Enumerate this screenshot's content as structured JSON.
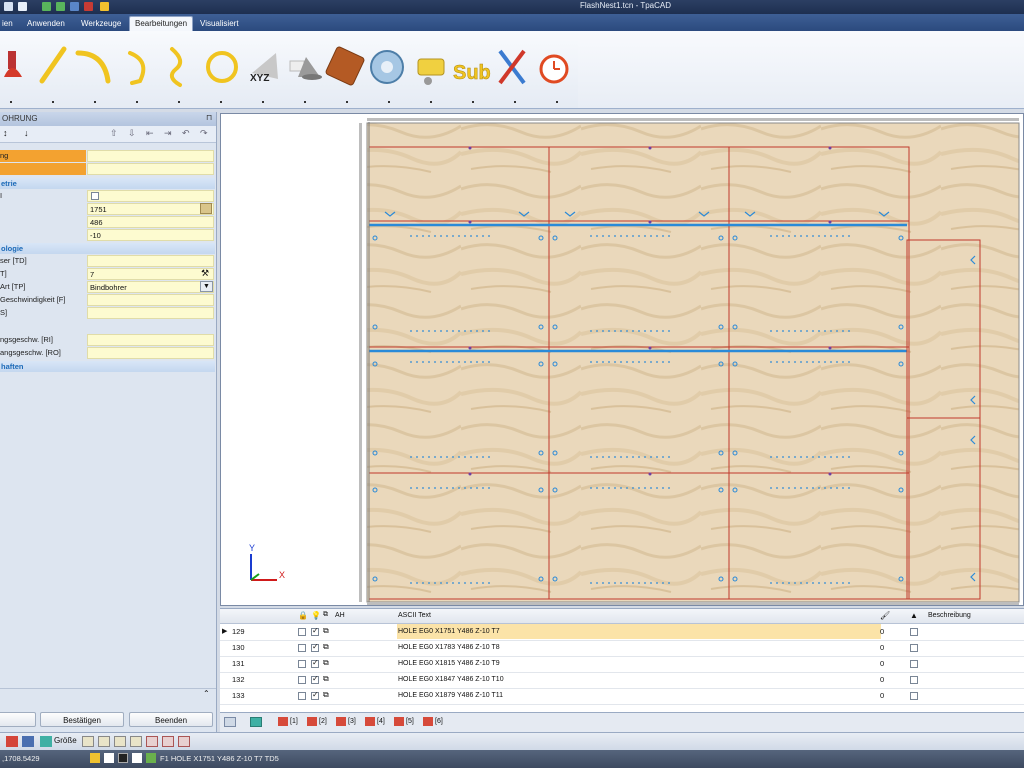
{
  "app": {
    "title": "FlashNest1.tcn - TpaCAD"
  },
  "ribbon_tabs": [
    {
      "label": "ien"
    },
    {
      "label": "Anwenden"
    },
    {
      "label": "Werkzeuge"
    },
    {
      "label": "Bearbeitungen"
    },
    {
      "label": "Visualisiert"
    }
  ],
  "ribbon_icons": {
    "sub_label": "Sub",
    "xyz_label": "XYZ"
  },
  "left_panel": {
    "title": "OHRUNG",
    "rows": [
      {
        "label": "ng",
        "value": "",
        "highlight": "orange"
      },
      {
        "label": "",
        "value": "",
        "highlight": "orange"
      }
    ],
    "cat1": "etrie",
    "geo_rows": [
      {
        "label": "I",
        "value": ""
      },
      {
        "label": "",
        "value": "1751"
      },
      {
        "label": "",
        "value": "486"
      },
      {
        "label": "",
        "value": "-10"
      }
    ],
    "cat2": "ologie",
    "tech_rows": [
      {
        "label": "ser [TD]",
        "value": ""
      },
      {
        "label": "T]",
        "value": "7"
      },
      {
        "label": "Art [TP]",
        "value": "Bindbohrer"
      },
      {
        "label": "Geschwindigkeit [F]",
        "value": ""
      },
      {
        "label": "S]",
        "value": ""
      }
    ],
    "extra_rows": [
      {
        "label": "ngsgeschw. [RI]",
        "value": ""
      },
      {
        "label": "angsgeschw. [RO]",
        "value": ""
      }
    ],
    "cat3": "haften",
    "buttons": {
      "confirm": "Bestätigen",
      "end": "Beenden"
    }
  },
  "axes": {
    "y": "Y",
    "x": "X"
  },
  "grid": {
    "headers": {
      "ascii": "ASCII Text",
      "desc": "Beschreibung",
      "ah": "AH"
    },
    "rows": [
      {
        "num": "129",
        "text": "HOLE EG0 X1751 Y486 Z-10 T7",
        "val": "0",
        "current": true,
        "checked": true
      },
      {
        "num": "130",
        "text": "HOLE EG0 X1783 Y486 Z-10 T8",
        "val": "0",
        "current": false,
        "checked": true
      },
      {
        "num": "131",
        "text": "HOLE EG0 X1815 Y486 Z-10 T9",
        "val": "0",
        "current": false,
        "checked": true
      },
      {
        "num": "132",
        "text": "HOLE EG0 X1847 Y486 Z-10 T10",
        "val": "0",
        "current": false,
        "checked": true
      },
      {
        "num": "133",
        "text": "HOLE EG0 X1879 Y486 Z-10 T11",
        "val": "0",
        "current": false,
        "checked": true
      }
    ]
  },
  "sheet_tabs": [
    "[1]",
    "[2]",
    "[3]",
    "[4]",
    "[5]",
    "[6]"
  ],
  "toolbar2": {
    "size_label": "Größe"
  },
  "status": {
    "coords": ",1708.5429",
    "info": "F1 HOLE X1751 Y486 Z-10 T7 TD5"
  },
  "colors": {
    "accent": "#f2a43a",
    "wood": "#e8d3b3",
    "panel_border": "#c0392b",
    "groove": "#2a8ad8"
  }
}
